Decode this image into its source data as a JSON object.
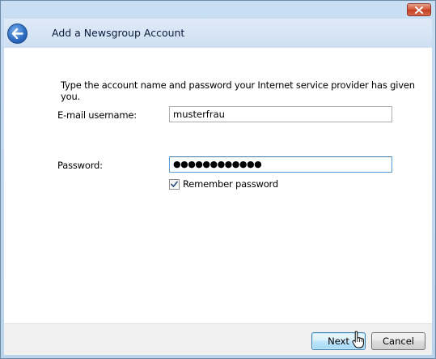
{
  "window": {
    "title": "Add a Newsgroup Account"
  },
  "icons": {
    "close": "close-icon",
    "back": "back-arrow-icon",
    "check": "check-icon",
    "cursor": "hand-pointer-icon"
  },
  "form": {
    "instruction": "Type the account name and password your Internet service provider has given you.",
    "username_label": "E-mail username:",
    "username_value": "musterfrau",
    "password_label": "Password:",
    "password_value": "●●●●●●●●●●●●",
    "remember_label": "Remember password",
    "remember_checked": true
  },
  "footer": {
    "next_label": "Next",
    "cancel_label": "Cancel"
  },
  "colors": {
    "frame": "#c9def3",
    "default_button_border": "#3c7fb1",
    "close_button": "#d3563a"
  }
}
